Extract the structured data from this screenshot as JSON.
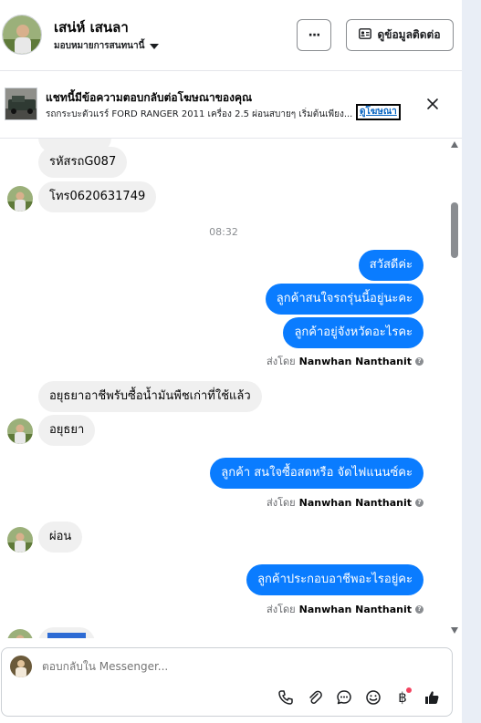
{
  "header": {
    "name": "เสน่ห์ เสนลา",
    "assignee": "มอบหมายการสนทนานี้",
    "more_label": "···",
    "contact_label": "ดูข้อมูลติดต่อ"
  },
  "ad": {
    "title": "แชทนี้มีข้อความตอบกลับต่อโฆษณาของคุณ",
    "description": "รถกระบะตัวแรร์ FORD RANGER 2011 เครื่อง 2.5 ผ่อนสบายๆ เริ่มต้นเพียง...",
    "link_label": "ดูโฆษณา"
  },
  "messages": {
    "m1": "รหัสรถG087",
    "m2": "โทร0620631749",
    "time": "08:32",
    "m3": "สวัสดีค่ะ",
    "m4": "ลูกค้าสนใจรถรุ่นนี้อยู่นะคะ",
    "m5": "ลูกค้าอยู่จังหวัดอะไรคะ",
    "m6": "อยุธยาอาชีพรับซื้อน้ำมันพืชเก่าที่ใช้แล้ว",
    "m7": "อยุธยา",
    "m8": "ลูกค้า สนใจซื้อสดหรือ จัดไฟแนนซ์คะ",
    "m9": "ผ่อน",
    "m10": "ลูกค้าประกอบอาชีพอะไรอยู่คะ"
  },
  "sent_by": {
    "prefix": "ส่งโดย",
    "name": "Nanwhan Nanthanit"
  },
  "composer": {
    "placeholder": "ตอบกลับใน Messenger..."
  },
  "icons": {
    "more": "more-icon",
    "contact": "contact-card-icon",
    "close": "close-icon",
    "call": "phone-icon",
    "attach": "paperclip-icon",
    "reply": "chat-bubble-icon",
    "emoji": "emoji-icon",
    "payment": "baht-icon",
    "like": "thumbs-up-icon"
  },
  "colors": {
    "accent": "#0a7cff",
    "incoming": "#f0f0f0"
  }
}
